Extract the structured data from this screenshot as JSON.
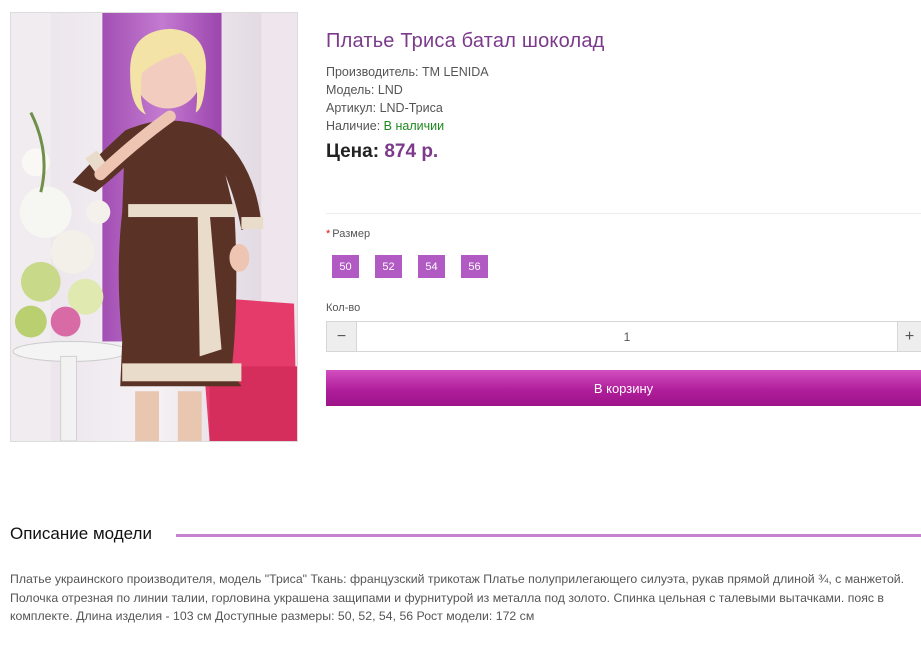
{
  "product": {
    "title": "Платье Триса батал шоколад",
    "manufacturer_label": "Производитель:",
    "manufacturer": "TM LENIDA",
    "model_label": "Модель:",
    "model": "LND",
    "sku_label": "Артикул:",
    "sku": "LND-Триса",
    "availability_label": "Наличие:",
    "availability": "В наличии",
    "price_label": "Цена:",
    "price": "874 р."
  },
  "options": {
    "size_required": "*",
    "size_label": "Размер",
    "sizes": [
      "50",
      "52",
      "54",
      "56"
    ],
    "qty_label": "Кол-во",
    "qty_minus": "−",
    "qty_plus": "+",
    "qty_value": "1"
  },
  "cart": {
    "button_label": "В корзину"
  },
  "description": {
    "title": "Описание модели",
    "text": "Платье украинского производителя, модель \"Триса\" Ткань: французский трикотаж Платье полуприлегающего силуэта, рукав прямой длиной ¾, с манжетой. Полочка отрезная по линии талии, горловина украшена защипами и фурнитурой из металла под золото. Спинка цельная с талевыми вытачками. пояс в комплекте. Длина изделия - 103 см Доступные размеры: 50, 52, 54, 56 Рост модели: 172 см"
  },
  "colors": {
    "accent": "#7b3a8a",
    "size_button": "#b25ac3",
    "cart_button": "#b01e9b",
    "in_stock": "#1e8a1e",
    "description_line": "#c583cf"
  }
}
